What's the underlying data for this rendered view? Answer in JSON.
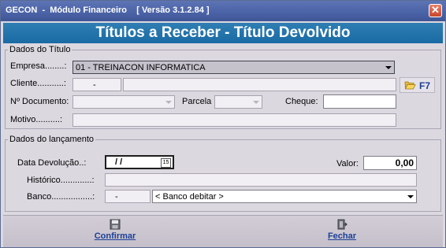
{
  "window": {
    "title": "GECON  -  Módulo Financeiro    [ Versão 3.1.2.84 ]",
    "close_glyph": "✕"
  },
  "header": {
    "title": "Títulos a Receber - Título Devolvido"
  },
  "titulo": {
    "legend": "Dados do Título",
    "empresa_label": "Empresa........:",
    "empresa_value": "01 - TREINACON INFORMATICA",
    "cliente_label": "Cliente...........:",
    "cliente_code": "-",
    "cliente_name": "",
    "f7_label": "F7",
    "f7_icon": "folder-open-icon",
    "documento_label": "Nº Documento:",
    "documento_value": "",
    "parcela_label": "Parcela",
    "parcela_value": "",
    "cheque_label": "Cheque:",
    "cheque_value": "",
    "motivo_label": "Motivo..........:",
    "motivo_value": ""
  },
  "lancamento": {
    "legend": "Dados do lançamento",
    "data_label": "Data Devolução..:",
    "data_value": " / /",
    "calendar_glyph": "15",
    "valor_label": "Valor:",
    "valor_value": "0,00",
    "historico_label": "Histórico.............:",
    "historico_value": "",
    "banco_label": "Banco.................:",
    "banco_code": "-",
    "banco_select": "< Banco debitar >"
  },
  "footer": {
    "confirmar_label": "Confirmar",
    "confirmar_icon": "floppy-disk-icon",
    "fechar_label": "Fechar",
    "fechar_icon": "exit-door-icon"
  },
  "colors": {
    "titlebar": "#4a62a6",
    "header": "#1a6aa4",
    "background": "#dcd8e0",
    "button_text": "#1c3f96"
  }
}
